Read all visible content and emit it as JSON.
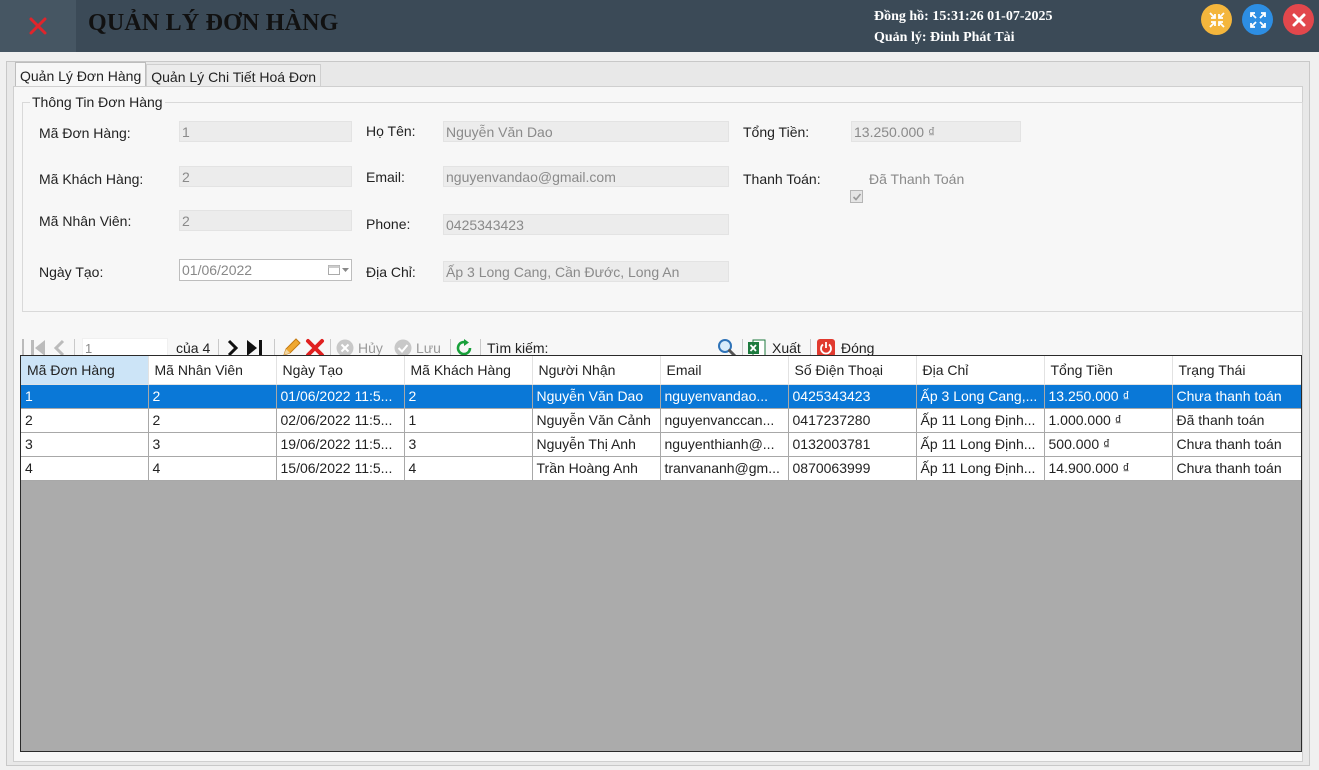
{
  "title": "QUẢN LÝ ĐƠN HÀNG",
  "header_info": {
    "clock": "Đồng hồ: 15:31:26 01-07-2025",
    "manager": "Quản lý: Đinh Phát Tài"
  },
  "tabs": [
    {
      "label": "Quản Lý Đơn Hàng",
      "active": true
    },
    {
      "label": "Quản Lý Chi Tiết Hoá Đơn",
      "active": false
    }
  ],
  "order_info": {
    "group_title": "Thông Tin Đơn Hàng",
    "ma_don_hang": {
      "label": "Mã Đơn Hàng:",
      "value": "1"
    },
    "ma_khach_hang": {
      "label": "Mã Khách Hàng:",
      "value": "2"
    },
    "ma_nhan_vien": {
      "label": "Mã Nhân Viên:",
      "value": "2"
    },
    "ngay_tao": {
      "label": "Ngày Tạo:",
      "value": "01/06/2022"
    },
    "ho_ten": {
      "label": "Họ Tên:",
      "value": "Nguyễn Văn Dao"
    },
    "email": {
      "label": "Email:",
      "value": "nguyenvandao@gmail.com"
    },
    "phone": {
      "label": "Phone:",
      "value": "0425343423"
    },
    "dia_chi": {
      "label": "Địa Chỉ:",
      "value": "Ấp 3 Long Cang, Cần Đước, Long An"
    },
    "tong_tien": {
      "label": "Tổng Tiền:",
      "value": "13.250.000 ₫"
    },
    "thanh_toan": {
      "label": "Thanh Toán:",
      "checkbox_label": "Đã Thanh Toán",
      "checked": true
    }
  },
  "toolbar": {
    "position": "1",
    "of_count": "của 4",
    "cancel_label": "Hủy",
    "save_label": "Lưu",
    "search_label": "Tìm kiếm:",
    "search_value": "",
    "export_label": "Xuất",
    "close_label": "Đóng"
  },
  "grid": {
    "columns": [
      "Mã Đơn Hàng",
      "Mã Nhân Viên",
      "Ngày Tạo",
      "Mã Khách Hàng",
      "Người Nhận",
      "Email",
      "Số Điện Thoại",
      "Địa Chỉ",
      "Tổng Tiền",
      "Trạng Thái"
    ],
    "rows": [
      [
        "1",
        "2",
        "01/06/2022 11:5...",
        "2",
        "Nguyễn Văn Dao",
        "nguyenvandao...",
        "0425343423",
        "Ấp 3 Long Cang,...",
        "13.250.000 ₫",
        "Chưa thanh toán"
      ],
      [
        "2",
        "2",
        "02/06/2022 11:5...",
        "1",
        "Nguyễn Văn Cảnh",
        "nguyenvanccan...",
        "0417237280",
        "Ấp 11 Long Định...",
        "1.000.000 ₫",
        "Đã thanh toán"
      ],
      [
        "3",
        "3",
        "19/06/2022 11:5...",
        "3",
        "Nguyễn Thị Anh",
        "nguyenthianh@...",
        "0132003781",
        "Ấp 11 Long Định...",
        "500.000 ₫",
        "Chưa thanh toán"
      ],
      [
        "4",
        "4",
        "15/06/2022 11:5...",
        "4",
        "Trần Hoàng Anh",
        "tranvananh@gm...",
        "0870063999",
        "Ấp 11 Long Định...",
        "14.900.000 ₫",
        "Chưa thanh toán"
      ]
    ],
    "selected_row": 0
  },
  "colors": {
    "titlebar": "#3b4a57",
    "selection": "#0a78d7",
    "grid_empty": "#ababab"
  }
}
